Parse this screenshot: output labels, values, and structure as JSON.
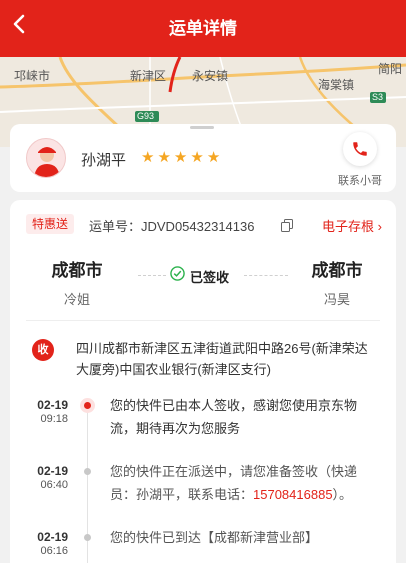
{
  "header": {
    "title": "运单详情"
  },
  "map": {
    "labels": {
      "qionglai": "邛崃市",
      "xinjin": "新津区",
      "yongan": "永安镇",
      "haiyu": "海棠镇",
      "jianyang": "简阳",
      "road": "G93",
      "s3": "S3"
    }
  },
  "courier": {
    "name": "孙湖平",
    "rating": 5,
    "contact_label": "联系小哥"
  },
  "waybill": {
    "badge": "特惠送",
    "number_label": "运单号：JDVD05432314136",
    "receipt_link": "电子存根 ›",
    "from_city": "成都市",
    "from_person": "冷姐",
    "to_city": "成都市",
    "to_person": "冯昊",
    "status": "已签收",
    "address_icon": "收",
    "address": "四川成都市新津区五津街道武阳中路26号(新津荣达大厦旁)中国农业银行(新津区支行)"
  },
  "timeline": [
    {
      "date": "02-19",
      "time": "09:18",
      "text": "您的快件已由本人签收，感谢您使用京东物流，期待再次为您服务"
    },
    {
      "date": "02-19",
      "time": "06:40",
      "text_before": "您的快件正在派送中，请您准备签收（快递员：孙湖平，联系电话：",
      "phone": "15708416885",
      "text_after": "）。"
    },
    {
      "date": "02-19",
      "time": "06:16",
      "text": "您的快件已到达【成都新津营业部】"
    }
  ],
  "colors": {
    "brand": "#e2231a",
    "star": "#f5a623"
  }
}
